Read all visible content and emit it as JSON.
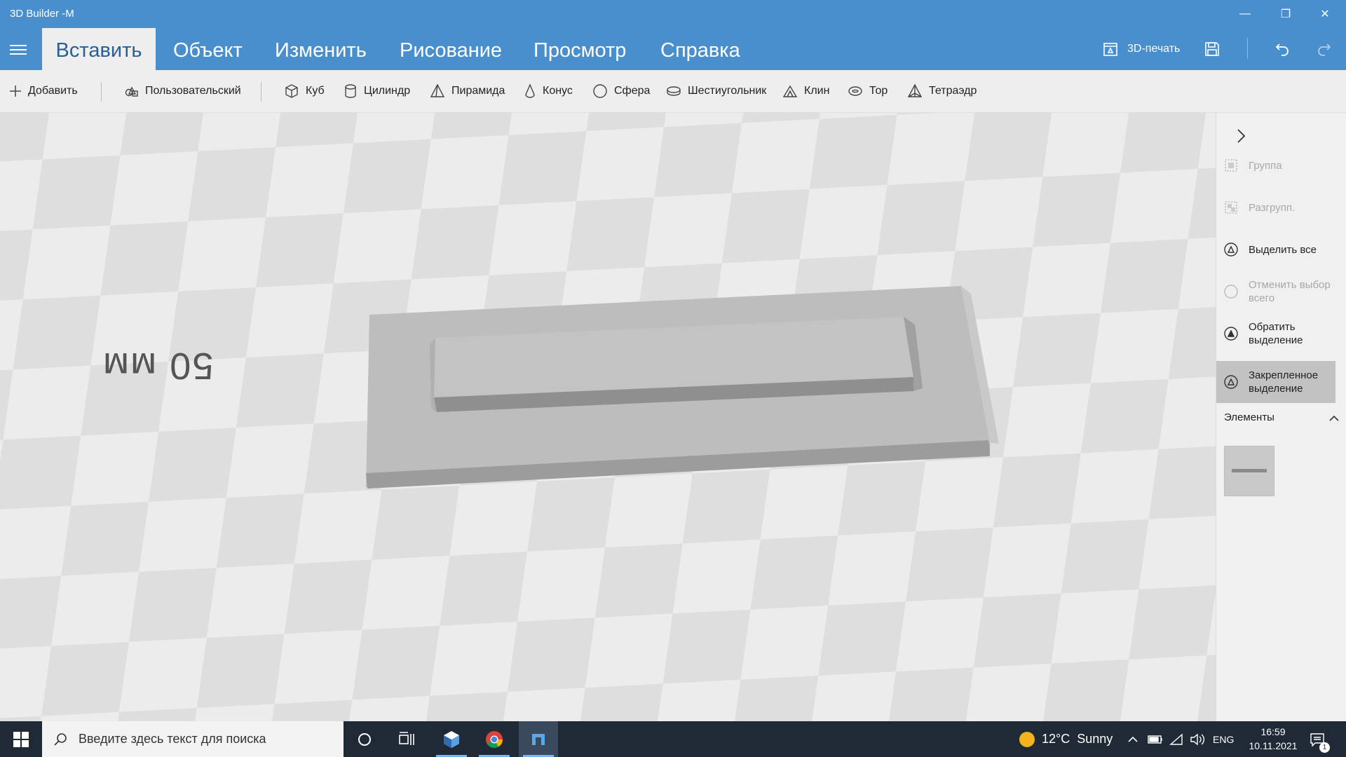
{
  "window": {
    "title": "3D Builder -M",
    "controls": {
      "minimize": "—",
      "restore": "❐",
      "close": "✕"
    }
  },
  "menu": {
    "tabs": [
      {
        "label": "Вставить",
        "active": true
      },
      {
        "label": "Объект"
      },
      {
        "label": "Изменить"
      },
      {
        "label": "Рисование"
      },
      {
        "label": "Просмотр"
      },
      {
        "label": "Справка"
      }
    ],
    "print_label": "3D-печать"
  },
  "ribbon": {
    "add": "Добавить",
    "custom": "Пользовательский",
    "shapes": [
      "Куб",
      "Цилиндр",
      "Пирамида",
      "Конус",
      "Сфера",
      "Шестиугольник",
      "Клин",
      "Тор",
      "Тетраэдр"
    ]
  },
  "viewport": {
    "scale_label": "50 мм",
    "floor_light": "#eeeeee",
    "floor_dark": "#dcdcdc"
  },
  "panel": {
    "items": [
      {
        "label": "Группа",
        "state": "disabled"
      },
      {
        "label": "Разгрупп.",
        "state": "disabled"
      },
      {
        "label": "Выделить все",
        "state": "enabled"
      },
      {
        "label": "Отменить выбор всего",
        "state": "disabled"
      },
      {
        "label": "Обратить выделение",
        "state": "enabled"
      },
      {
        "label": "Закрепленное выделение",
        "state": "selected"
      }
    ],
    "elements_label": "Элементы"
  },
  "taskbar": {
    "search_placeholder": "Введите здесь текст для поиска",
    "weather_temp": "12°C",
    "weather_text": "Sunny",
    "language": "ENG",
    "time": "16:59",
    "date": "10.11.2021",
    "notification_count": "1"
  },
  "colors": {
    "accent": "#4a8fcd",
    "taskbar": "#1f2a36",
    "selected": "#c2c2c2"
  }
}
